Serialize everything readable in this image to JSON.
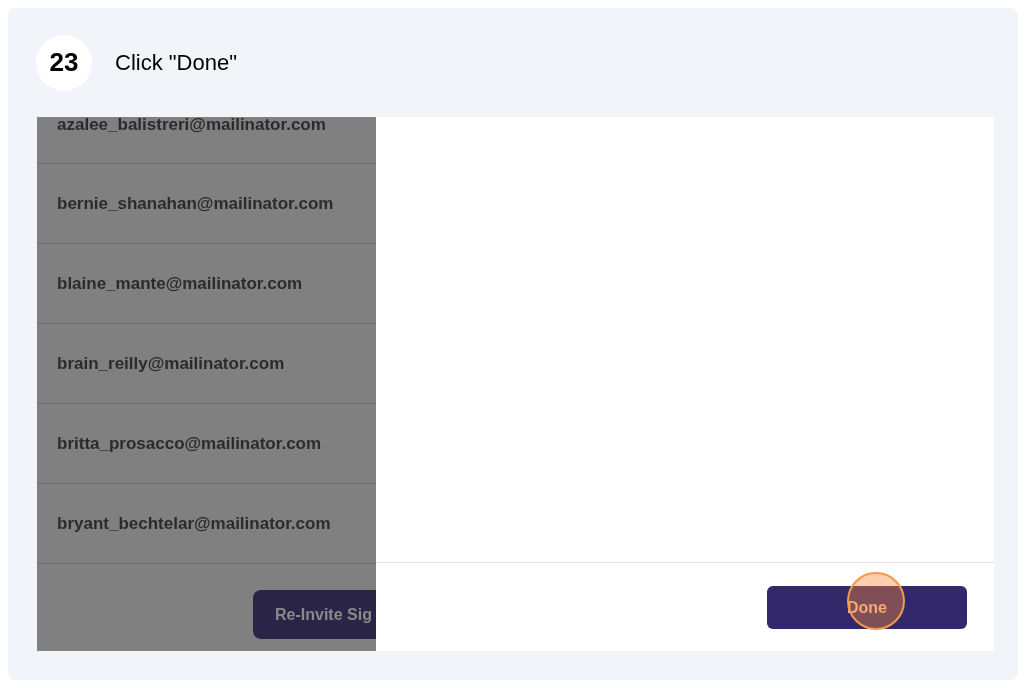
{
  "step": {
    "number": "23",
    "instruction": "Click \"Done\""
  },
  "emails": [
    "azalee_balistreri@mailinator.com",
    "bernie_shanahan@mailinator.com",
    "blaine_mante@mailinator.com",
    "brain_reilly@mailinator.com",
    "britta_prosacco@mailinator.com",
    "bryant_bechtelar@mailinator.com"
  ],
  "reinvite_button": "Re-Invite Sig",
  "done_button": "Done"
}
